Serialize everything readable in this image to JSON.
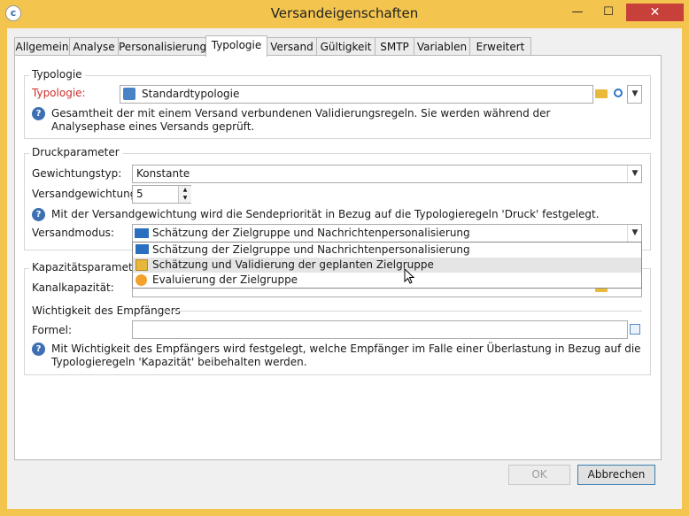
{
  "window": {
    "title": "Versandeigenschaften",
    "minimize": "—",
    "maximize": "☐",
    "close": "✕"
  },
  "tabs": [
    {
      "label": "Allgemein"
    },
    {
      "label": "Analyse"
    },
    {
      "label": "Personalisierung"
    },
    {
      "label": "Typologie"
    },
    {
      "label": "Versand"
    },
    {
      "label": "Gültigkeit"
    },
    {
      "label": "SMTP"
    },
    {
      "label": "Variablen"
    },
    {
      "label": "Erweitert"
    }
  ],
  "active_tab": "Typologie",
  "typologie": {
    "group_title": "Typologie",
    "label": "Typologie:",
    "value": "Standardtypologie",
    "help": "Gesamtheit der mit einem Versand verbundenen Validierungsregeln. Sie werden während der Analysephase eines Versands geprüft."
  },
  "druck": {
    "group_title": "Druckparameter",
    "gewichtungstyp_label": "Gewichtungstyp:",
    "gewichtungstyp_value": "Konstante",
    "versandgewichtung_label": "Versandgewichtung:",
    "versandgewichtung_value": "5",
    "help": "Mit der Versandgewichtung wird die Sendepriorität in Bezug auf die Typologieregeln 'Druck' festgelegt.",
    "versandmodus_label": "Versandmodus:",
    "versandmodus_value": "Schätzung der Zielgruppe und Nachrichtenpersonalisierung",
    "versandmodus_options": [
      {
        "label": "Schätzung der Zielgruppe und Nachrichtenpersonalisierung",
        "icon": "envelope-icon"
      },
      {
        "label": "Schätzung und Validierung der geplanten Zielgruppe",
        "icon": "calendar-icon"
      },
      {
        "label": "Evaluierung der Zielgruppe",
        "icon": "play-icon"
      }
    ]
  },
  "kapazitaet": {
    "group_title": "Kapazitätsparameter",
    "kanal_label": "Kanalkapazität:",
    "wichtigkeit_title": "Wichtigkeit des Empfängers",
    "formel_label": "Formel:",
    "formel_value": "",
    "help": "Mit Wichtigkeit des Empfängers wird festgelegt, welche Empfänger im Falle einer Überlastung in Bezug auf die Typologieregeln 'Kapazität' beibehalten werden."
  },
  "buttons": {
    "ok": "OK",
    "cancel": "Abbrechen"
  },
  "colors": {
    "title_bar": "#f3c54e",
    "close_button": "#c7403a",
    "required_label": "#c9302c",
    "help_icon": "#3d6fb4"
  }
}
